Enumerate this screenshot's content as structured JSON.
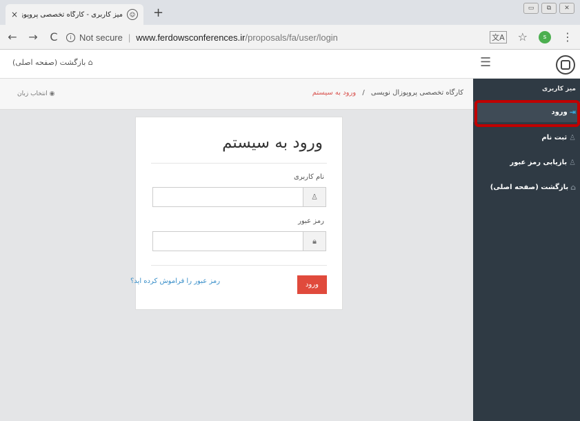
{
  "browser": {
    "tab_title": "میز کاربری - کارگاه تخصصی پروپوزال نو",
    "tab_close": "×",
    "new_tab": "+",
    "window_controls": {
      "minimize": "▭",
      "maximize": "⧉",
      "close": "✕"
    },
    "address": {
      "security_label": "Not secure",
      "separator": "|",
      "host": "www.ferdowsconferences.ir",
      "path": "/proposals/fa/user/login"
    },
    "nav": {
      "back": "←",
      "forward": "→",
      "reload": "C"
    },
    "profile_initial": "s"
  },
  "header": {
    "home_link": "⌂ بازگشت (صفحه اصلی)",
    "hamburger": "☰"
  },
  "breadcrumb": {
    "lang_label": "◉ انتخاب زبان",
    "items": [
      "کارگاه تخصصی پروپوزال نویسی",
      "ورود به سیستم"
    ],
    "separator": "/"
  },
  "login": {
    "title": "ورود به سیستم",
    "username_label": "نام کاربری",
    "username_value": "",
    "password_label": "رمز عبور",
    "password_value": "",
    "submit_label": "ورود",
    "forgot_label": "رمز عبور را فراموش کرده اید؟"
  },
  "sidebar": {
    "heading": "میز کاربری",
    "items": [
      {
        "label": "ورود",
        "icon": "login-icon",
        "active": true
      },
      {
        "label": "ثبت نام",
        "icon": "user-icon",
        "active": false
      },
      {
        "label": "بازیابی رمز عبور",
        "icon": "user-icon",
        "active": false
      },
      {
        "label": "بازگشت (صفحه اصلی)",
        "icon": "home-icon",
        "active": false
      }
    ]
  },
  "colors": {
    "sidebar_bg": "#2f3a44",
    "accent_red": "#e04a3c",
    "link_blue": "#3a8fc9",
    "highlight_ring": "#c00000"
  }
}
